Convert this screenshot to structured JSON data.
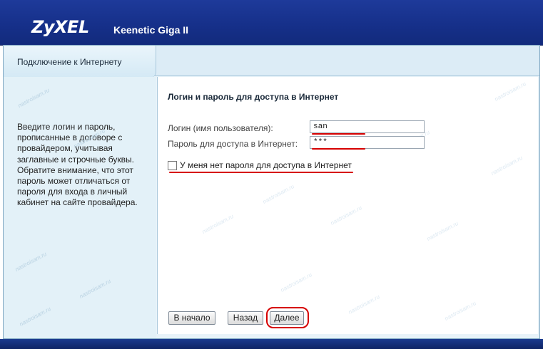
{
  "header": {
    "logo": "ZyXEL",
    "model": "Keenetic Giga II",
    "color": "#1b3592"
  },
  "tab": {
    "label": "Подключение к Интернету"
  },
  "help_text": "Введите логин и пароль, прописанные в договоре с провайдером, учитывая заглавные и строчные буквы. Обратите внимание, что этот пароль может отличаться от пароля для входа в личный кабинет на сайте провайдера.",
  "form": {
    "section_title": "Логин и пароль для доступа в Интернет",
    "login_label": "Логин (имя пользователя):",
    "login_value": "san",
    "password_label": "Пароль для доступа в Интернет:",
    "password_value": "***",
    "no_password_label": "У меня нет пароля для доступа в Интернет",
    "no_password_checked": false
  },
  "buttons": {
    "start": "В начало",
    "back": "Назад",
    "next": "Далее"
  },
  "watermark": "nastroisam.ru",
  "highlight_color": "#d60000"
}
